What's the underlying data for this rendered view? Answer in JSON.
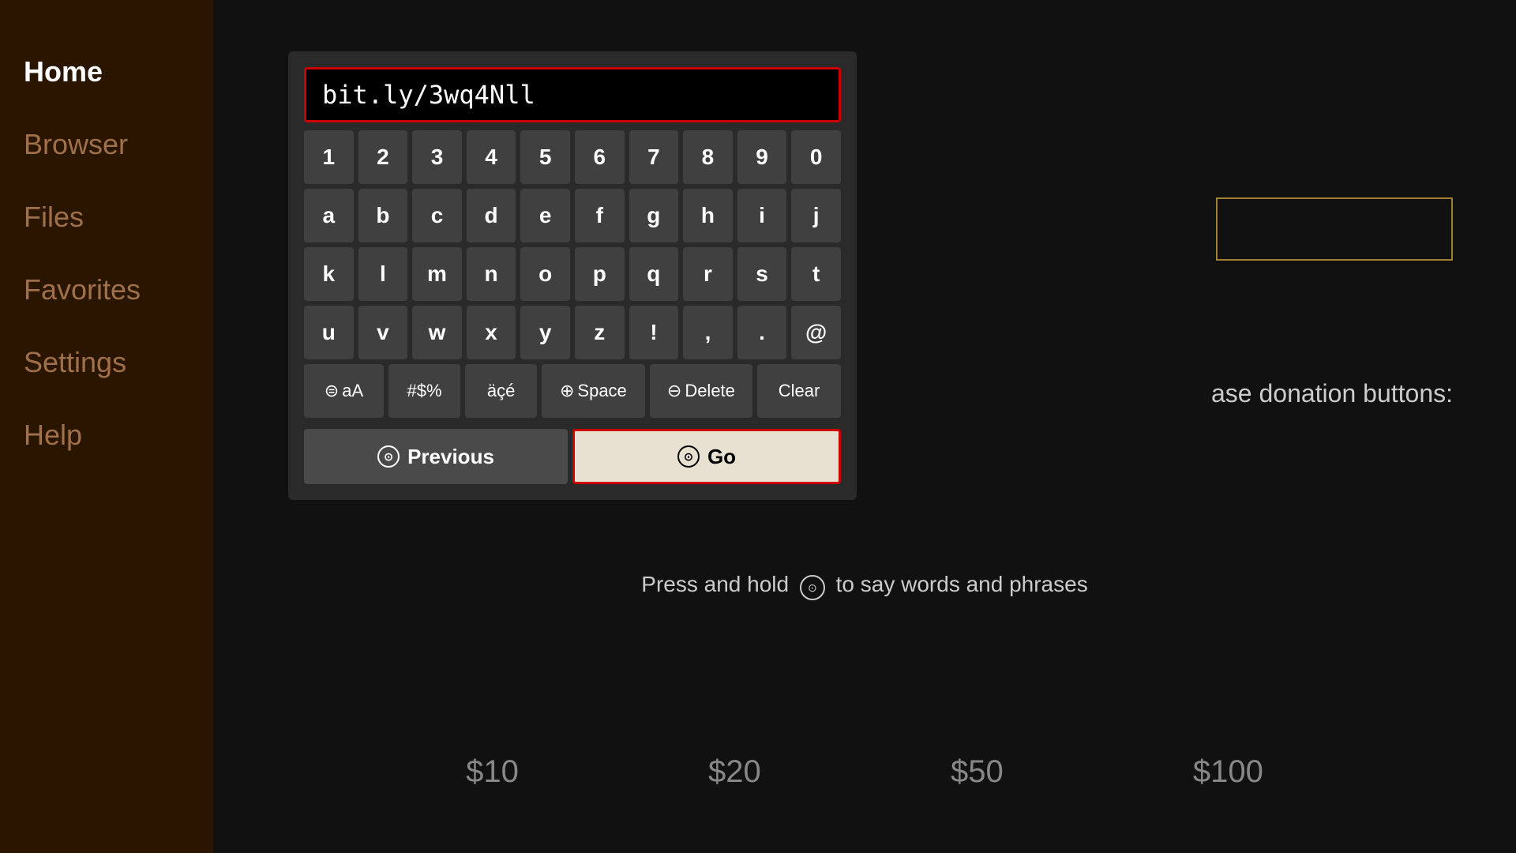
{
  "sidebar": {
    "items": [
      {
        "id": "home",
        "label": "Home",
        "active": true
      },
      {
        "id": "browser",
        "label": "Browser",
        "active": false
      },
      {
        "id": "files",
        "label": "Files",
        "active": false
      },
      {
        "id": "favorites",
        "label": "Favorites",
        "active": false
      },
      {
        "id": "settings",
        "label": "Settings",
        "active": false
      },
      {
        "id": "help",
        "label": "Help",
        "active": false
      }
    ]
  },
  "keyboard": {
    "url_value": "bit.ly/3wq4Nll",
    "url_placeholder": "",
    "rows": [
      [
        "1",
        "2",
        "3",
        "4",
        "5",
        "6",
        "7",
        "8",
        "9",
        "0"
      ],
      [
        "a",
        "b",
        "c",
        "d",
        "e",
        "f",
        "g",
        "h",
        "i",
        "j"
      ],
      [
        "k",
        "l",
        "m",
        "n",
        "o",
        "p",
        "q",
        "r",
        "s",
        "t"
      ],
      [
        "u",
        "v",
        "w",
        "x",
        "y",
        "z",
        "!",
        ",",
        ".",
        "@"
      ]
    ],
    "special_keys": {
      "case": "aA",
      "symbols": "#$%",
      "accent": "äçé",
      "space": "Space",
      "delete": "Delete",
      "clear": "Clear"
    },
    "nav": {
      "previous": "Previous",
      "go": "Go"
    }
  },
  "hint": {
    "text": "Press and hold",
    "suffix": "to say words and phrases"
  },
  "donation": {
    "label": "ase donation buttons:",
    "amounts": [
      "$10",
      "$20",
      "$50",
      "$100"
    ]
  },
  "colors": {
    "active_border": "#cc0000",
    "go_bg": "#e8e0d0",
    "sidebar_bg": "#2a1500",
    "key_bg": "#404040"
  }
}
